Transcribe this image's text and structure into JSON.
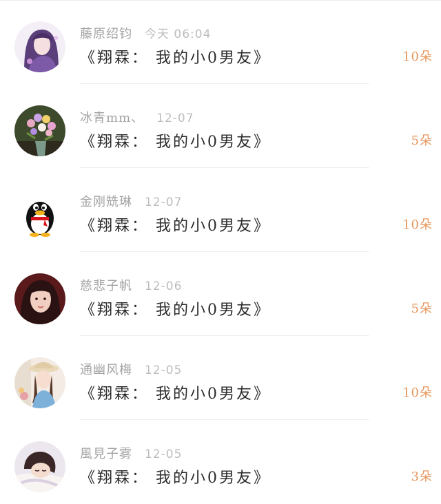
{
  "items": [
    {
      "name": "藤原绍钧",
      "time": "今天 06:04",
      "title": "《翔霖： 我的小0男友》",
      "amount": "10朵",
      "avatar": "anime-girl-avatar"
    },
    {
      "name": "冰青mm、",
      "time": "12-07",
      "title": "《翔霖： 我的小0男友》",
      "amount": "5朵",
      "avatar": "flower-bouquet-avatar"
    },
    {
      "name": "金刚兟琳",
      "time": "12-07",
      "title": "《翔霖： 我的小0男友》",
      "amount": "10朵",
      "avatar": "qq-penguin-avatar"
    },
    {
      "name": "慈悲子帆",
      "time": "12-06",
      "title": "《翔霖： 我的小0男友》",
      "amount": "5朵",
      "avatar": "woman-portrait-avatar"
    },
    {
      "name": "通幽风梅",
      "time": "12-05",
      "title": "《翔霖： 我的小0男友》",
      "amount": "10朵",
      "avatar": "girl-with-hat-avatar"
    },
    {
      "name": "風見子雾",
      "time": "12-05",
      "title": "《翔霖： 我的小0男友》",
      "amount": "3朵",
      "avatar": "sleeping-girl-avatar"
    }
  ]
}
